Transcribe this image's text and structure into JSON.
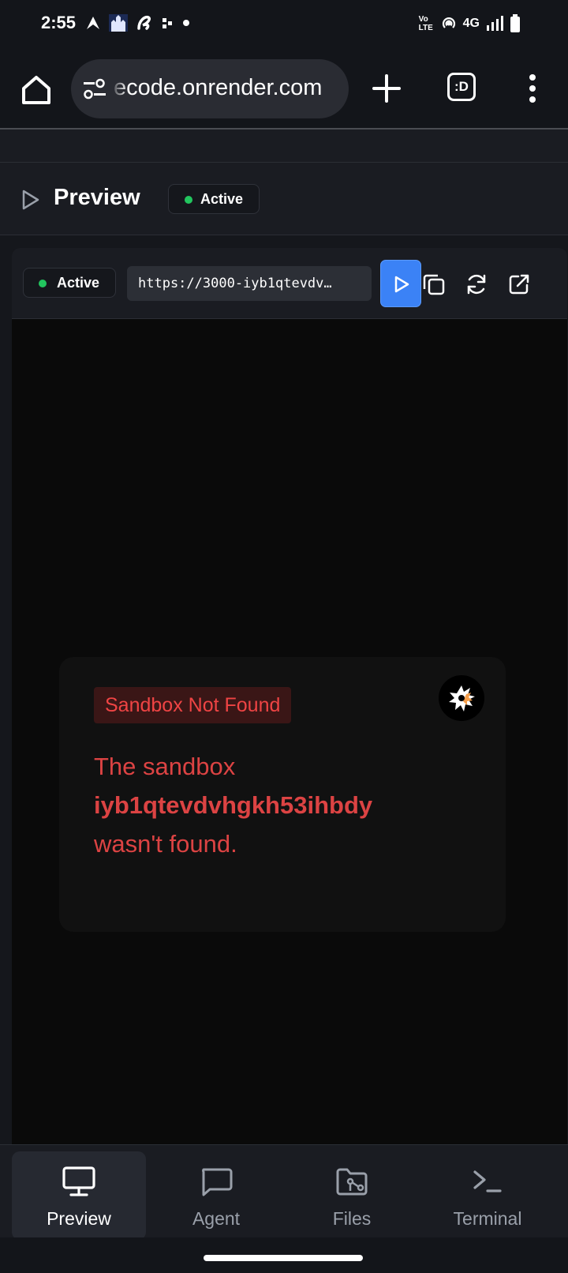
{
  "status_bar": {
    "time": "2:55",
    "network_label": "4G",
    "volte_label": "Vo LTE"
  },
  "browser": {
    "url": "ecode.onrender.com",
    "tabs_label": ":D",
    "icons": [
      "home-icon",
      "site-settings-icon",
      "plus-icon",
      "tab-switcher-icon",
      "more-vert-icon"
    ]
  },
  "header": {
    "title": "Preview",
    "status": "Active"
  },
  "preview_toolbar": {
    "status": "Active",
    "url_value": "https://3000-iyb1qtevdv…",
    "icons": [
      "play-icon",
      "copy-icon",
      "refresh-icon",
      "external-link-icon"
    ]
  },
  "error_card": {
    "tag": "Sandbox Not Found",
    "message_prefix": "The sandbox",
    "sandbox_id": "iyb1qtevdvhgkh53ihbdy",
    "message_suffix": "wasn't found."
  },
  "bottom_nav": {
    "items": [
      {
        "label": "Preview",
        "icon": "monitor-icon"
      },
      {
        "label": "Agent",
        "icon": "chat-icon"
      },
      {
        "label": "Files",
        "icon": "folder-icon"
      },
      {
        "label": "Terminal",
        "icon": "terminal-icon"
      }
    ],
    "active": "Preview"
  },
  "colors": {
    "accent_blue": "#3b82f6",
    "status_green": "#22c55e",
    "error_red": "#ef4444"
  }
}
